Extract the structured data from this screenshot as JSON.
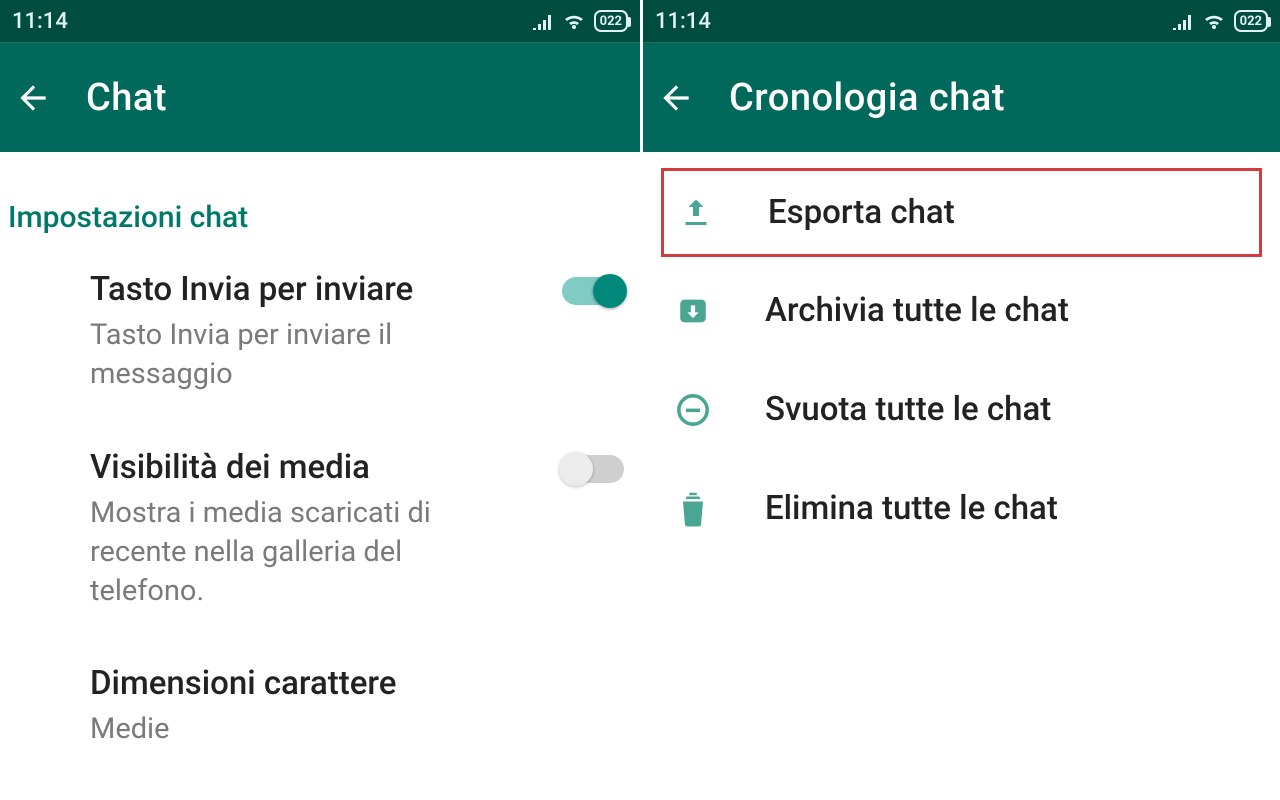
{
  "status": {
    "time": "11:14",
    "battery": "022"
  },
  "left": {
    "appbar_title": "Chat",
    "section_label": "Impostazioni chat",
    "rows": {
      "enter": {
        "title": "Tasto Invia per inviare",
        "sub": "Tasto Invia per inviare il messaggio"
      },
      "media": {
        "title": "Visibilità dei media",
        "sub": "Mostra i media scaricati di recente nella galleria del telefono."
      },
      "font": {
        "title": "Dimensioni carattere",
        "sub": "Medie"
      }
    }
  },
  "right": {
    "appbar_title": "Cronologia chat",
    "items": {
      "export": "Esporta chat",
      "archive": "Archivia tutte le chat",
      "clear": "Svuota tutte le chat",
      "delete": "Elimina tutte le chat"
    }
  }
}
